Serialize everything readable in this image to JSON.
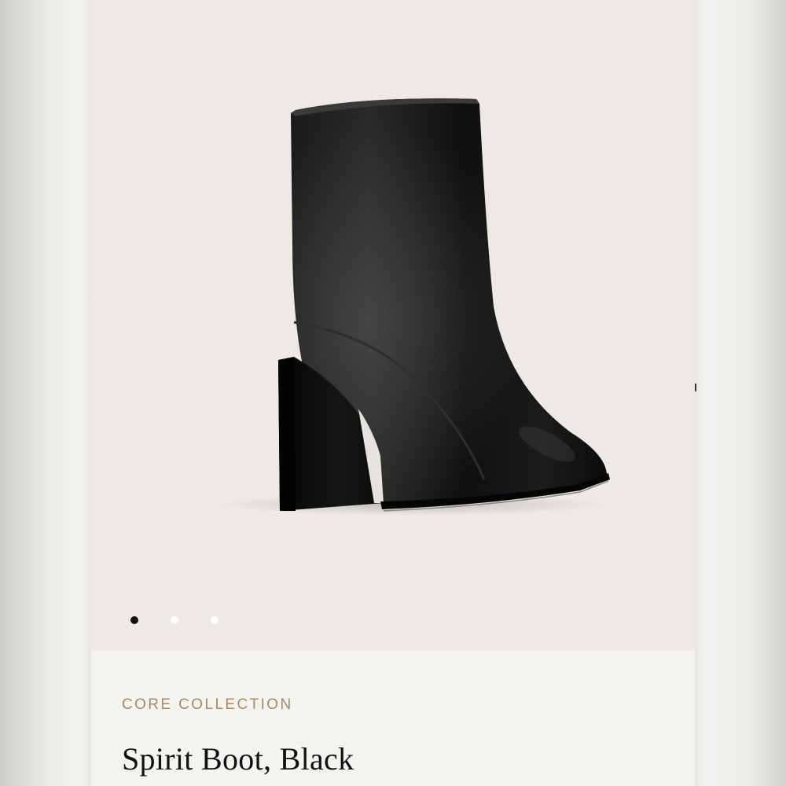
{
  "product": {
    "collection": "CORE COLLECTION",
    "name": "Spirit Boot, Black",
    "image_alt": "Spirit Boot, Black"
  },
  "gallery": {
    "image_count": 3,
    "active_index": 0
  },
  "colors": {
    "accent": "#a58a62",
    "gallery_background": "#edeae5",
    "page_background": "#f5f3f0",
    "active_dot": "#111111",
    "inactive_dot": "#ffffff"
  }
}
